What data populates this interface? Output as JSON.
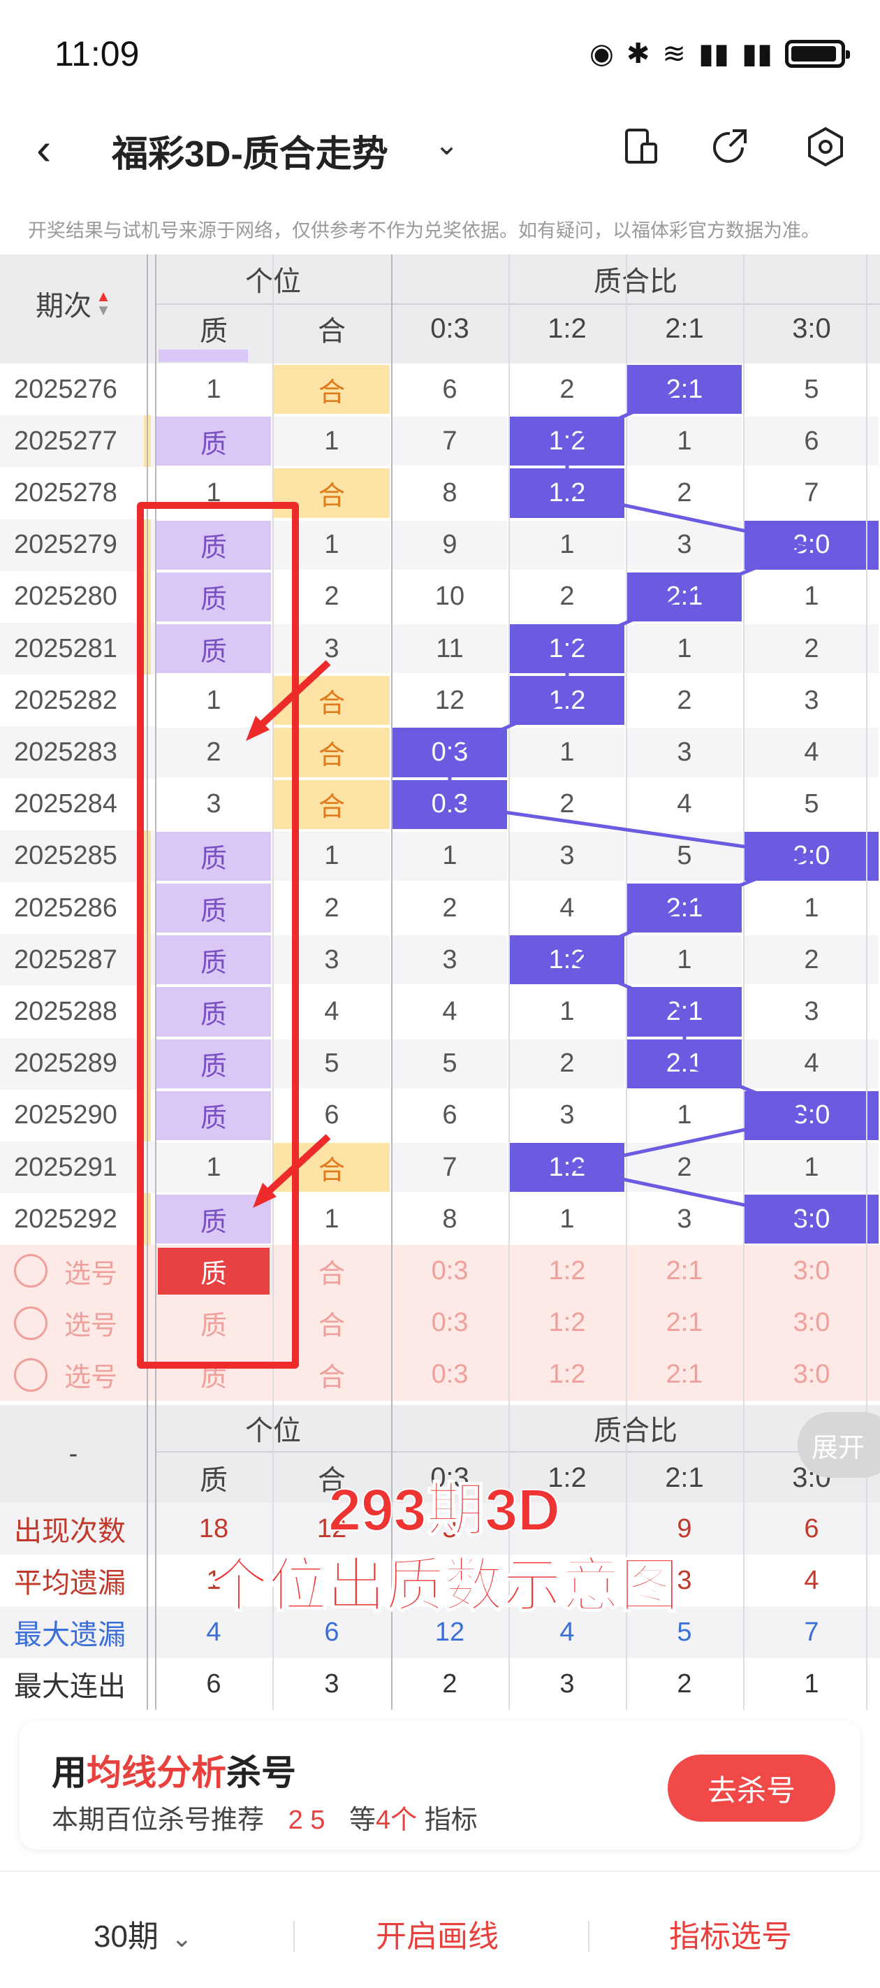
{
  "status_bar": {
    "time": "11:09"
  },
  "header": {
    "title": "福彩3D-质合走势"
  },
  "notice": "开奖结果与试机号来源于网络，仅供参考不作为兑奖依据。如有疑问，以福体彩官方数据为准。",
  "table": {
    "head": {
      "period_label": "期次",
      "group1": "个位",
      "group2": "质合比",
      "cols": [
        "质",
        "合",
        "0:3",
        "1:2",
        "2:1",
        "3:0"
      ]
    },
    "rows": [
      {
        "period": "2025276",
        "zhi": "1",
        "he": "合",
        "r03": "6",
        "r12": "2",
        "r21": "2:1",
        "r30": "5",
        "hit": "he",
        "ratio_hit": "r21"
      },
      {
        "period": "2025277",
        "zhi": "质",
        "he": "1",
        "r03": "7",
        "r12": "1:2",
        "r21": "1",
        "r30": "6",
        "hit": "zhi",
        "ratio_hit": "r12"
      },
      {
        "period": "2025278",
        "zhi": "1",
        "he": "合",
        "r03": "8",
        "r12": "1:2",
        "r21": "2",
        "r30": "7",
        "hit": "he",
        "ratio_hit": "r12"
      },
      {
        "period": "2025279",
        "zhi": "质",
        "he": "1",
        "r03": "9",
        "r12": "1",
        "r21": "3",
        "r30": "3:0",
        "hit": "zhi",
        "ratio_hit": "r30"
      },
      {
        "period": "2025280",
        "zhi": "质",
        "he": "2",
        "r03": "10",
        "r12": "2",
        "r21": "2:1",
        "r30": "1",
        "hit": "zhi",
        "ratio_hit": "r21"
      },
      {
        "period": "2025281",
        "zhi": "质",
        "he": "3",
        "r03": "11",
        "r12": "1:2",
        "r21": "1",
        "r30": "2",
        "hit": "zhi",
        "ratio_hit": "r12"
      },
      {
        "period": "2025282",
        "zhi": "1",
        "he": "合",
        "r03": "12",
        "r12": "1:2",
        "r21": "2",
        "r30": "3",
        "hit": "he",
        "ratio_hit": "r12"
      },
      {
        "period": "2025283",
        "zhi": "2",
        "he": "合",
        "r03": "0:3",
        "r12": "1",
        "r21": "3",
        "r30": "4",
        "hit": "he",
        "ratio_hit": "r03"
      },
      {
        "period": "2025284",
        "zhi": "3",
        "he": "合",
        "r03": "0:3",
        "r12": "2",
        "r21": "4",
        "r30": "5",
        "hit": "he",
        "ratio_hit": "r03"
      },
      {
        "period": "2025285",
        "zhi": "质",
        "he": "1",
        "r03": "1",
        "r12": "3",
        "r21": "5",
        "r30": "3:0",
        "hit": "zhi",
        "ratio_hit": "r30"
      },
      {
        "period": "2025286",
        "zhi": "质",
        "he": "2",
        "r03": "2",
        "r12": "4",
        "r21": "2:1",
        "r30": "1",
        "hit": "zhi",
        "ratio_hit": "r21"
      },
      {
        "period": "2025287",
        "zhi": "质",
        "he": "3",
        "r03": "3",
        "r12": "1:2",
        "r21": "1",
        "r30": "2",
        "hit": "zhi",
        "ratio_hit": "r12"
      },
      {
        "period": "2025288",
        "zhi": "质",
        "he": "4",
        "r03": "4",
        "r12": "1",
        "r21": "2:1",
        "r30": "3",
        "hit": "zhi",
        "ratio_hit": "r21"
      },
      {
        "period": "2025289",
        "zhi": "质",
        "he": "5",
        "r03": "5",
        "r12": "2",
        "r21": "2:1",
        "r30": "4",
        "hit": "zhi",
        "ratio_hit": "r21"
      },
      {
        "period": "2025290",
        "zhi": "质",
        "he": "6",
        "r03": "6",
        "r12": "3",
        "r21": "1",
        "r30": "3:0",
        "hit": "zhi",
        "ratio_hit": "r30"
      },
      {
        "period": "2025291",
        "zhi": "1",
        "he": "合",
        "r03": "7",
        "r12": "1:2",
        "r21": "2",
        "r30": "1",
        "hit": "he",
        "ratio_hit": "r12"
      },
      {
        "period": "2025292",
        "zhi": "质",
        "he": "1",
        "r03": "8",
        "r12": "1",
        "r21": "3",
        "r30": "3:0",
        "hit": "zhi",
        "ratio_hit": "r30"
      }
    ],
    "select_rows": [
      {
        "label": "选号",
        "cols": [
          "质",
          "合",
          "0:3",
          "1:2",
          "2:1",
          "3:0"
        ],
        "selected_col": 0
      },
      {
        "label": "选号",
        "cols": [
          "质",
          "合",
          "0:3",
          "1:2",
          "2:1",
          "3:0"
        ],
        "selected_col": -1
      },
      {
        "label": "选号",
        "cols": [
          "质",
          "合",
          "0:3",
          "1:2",
          "2:1",
          "3:0"
        ],
        "selected_col": -1
      }
    ],
    "stats_head": {
      "left": "-",
      "group1": "个位",
      "group2": "质合比",
      "cols": [
        "质",
        "合",
        "0:3",
        "1:2",
        "2:1",
        "3:0"
      ]
    },
    "stats": [
      {
        "label": "出现次数",
        "color": "#c0392b",
        "values": [
          "18",
          "12",
          "3",
          "",
          "9",
          "6"
        ]
      },
      {
        "label": "平均遗漏",
        "color": "#c0392b",
        "values": [
          "1",
          "",
          "",
          "",
          "3",
          "4"
        ]
      },
      {
        "label": "最大遗漏",
        "color": "#3a6fd8",
        "values": [
          "4",
          "6",
          "12",
          "4",
          "5",
          "7"
        ]
      },
      {
        "label": "最大连出",
        "color": "#333333",
        "values": [
          "6",
          "3",
          "2",
          "3",
          "2",
          "1"
        ]
      }
    ]
  },
  "annotation": {
    "line1": "293期3D",
    "line2": "个位出质数示意图"
  },
  "expand_label": "展开",
  "promo": {
    "title_pre": "用",
    "title_hl": "均线分析",
    "title_post": "杀号",
    "sub_pre": "本期百位杀号推荐",
    "sub_nums": "2 5",
    "sub_mid": "等",
    "sub_count": "4个",
    "sub_post": "指标",
    "button": "去杀号"
  },
  "bottom_bar": {
    "periods": "30期",
    "draw_line": "开启画线",
    "pick": "指标选号"
  },
  "colors": {
    "accent_red": "#e8413d",
    "ratio_blue": "#6b5be0",
    "zhi_purple": "#d9c7f5",
    "he_orange": "#fde3a6"
  }
}
